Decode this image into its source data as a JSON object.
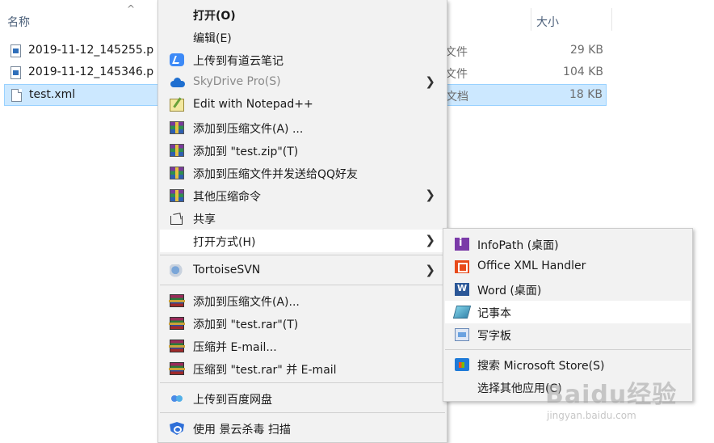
{
  "explorer": {
    "columns": {
      "name": "名称",
      "size": "大小"
    },
    "files": [
      {
        "name": "2019-11-12_145255.p",
        "type": "文件",
        "size": "29 KB"
      },
      {
        "name": "2019-11-12_145346.p",
        "type": "文件",
        "size": "104 KB"
      },
      {
        "name": "test.xml",
        "type": "文档",
        "size": "18 KB"
      }
    ]
  },
  "context_menu": {
    "items": [
      {
        "label": "打开(O)"
      },
      {
        "label": "编辑(E)"
      },
      {
        "label": "上传到有道云笔记"
      },
      {
        "label": "SkyDrive Pro(S)"
      },
      {
        "label": "Edit with Notepad++"
      },
      {
        "label": "添加到压缩文件(A) ..."
      },
      {
        "label": "添加到 \"test.zip\"(T)"
      },
      {
        "label": "添加到压缩文件并发送给QQ好友"
      },
      {
        "label": "其他压缩命令"
      },
      {
        "label": "共享"
      },
      {
        "label": "打开方式(H)"
      },
      {
        "label": "TortoiseSVN"
      },
      {
        "label": "添加到压缩文件(A)..."
      },
      {
        "label": "添加到 \"test.rar\"(T)"
      },
      {
        "label": "压缩并 E-mail..."
      },
      {
        "label": "压缩到 \"test.rar\" 并 E-mail"
      },
      {
        "label": "上传到百度网盘"
      },
      {
        "label": "使用 景云杀毒 扫描"
      }
    ]
  },
  "open_with_menu": {
    "items": [
      {
        "label": "InfoPath (桌面)"
      },
      {
        "label": "Office XML Handler"
      },
      {
        "label": "Word (桌面)"
      },
      {
        "label": "记事本"
      },
      {
        "label": "写字板"
      },
      {
        "label": "搜索 Microsoft Store(S)"
      },
      {
        "label": "选择其他应用(C)"
      }
    ]
  },
  "watermark": {
    "logo": "Baidu经验",
    "url": "jingyan.baidu.com"
  }
}
